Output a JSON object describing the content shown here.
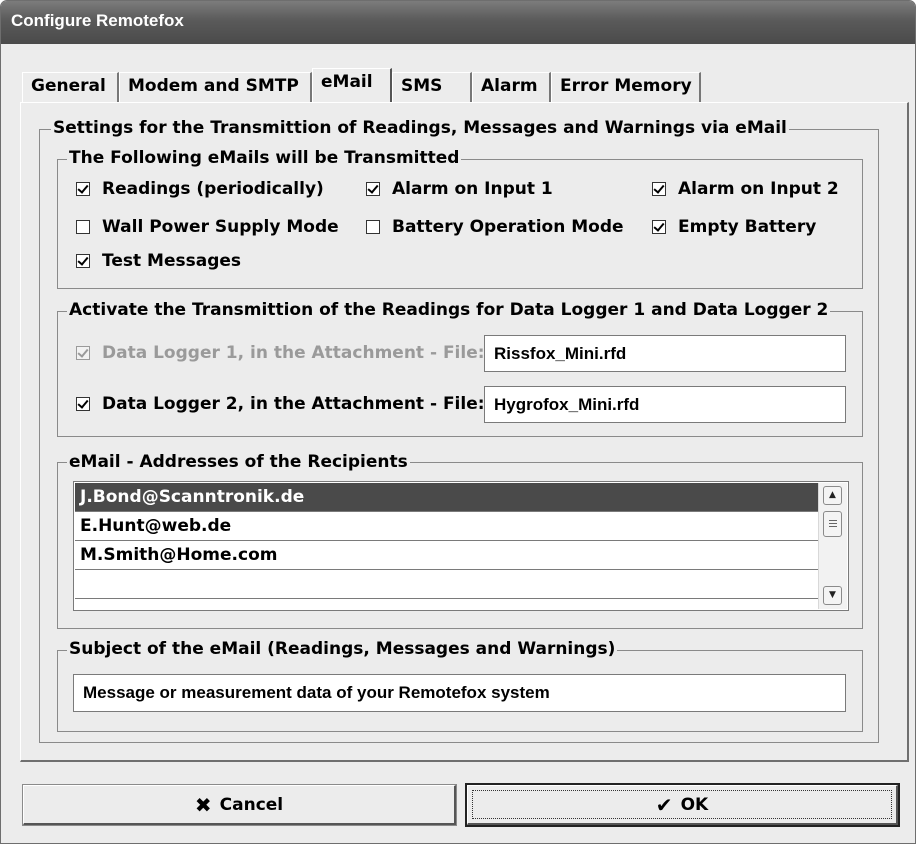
{
  "window": {
    "title": "Configure Remotefox"
  },
  "tabs": [
    {
      "label": "General"
    },
    {
      "label": "Modem and SMTP"
    },
    {
      "label": "eMail",
      "active": true
    },
    {
      "label": "SMS"
    },
    {
      "label": "Alarm"
    },
    {
      "label": "Error Memory"
    }
  ],
  "main": {
    "group_title": "Settings for the Transmittion of Readings, Messages and Warnings via eMail",
    "emails": {
      "title": "The Following eMails will be Transmitted",
      "options": [
        {
          "label": "Readings (periodically)",
          "checked": true
        },
        {
          "label": "Alarm on Input 1",
          "checked": true
        },
        {
          "label": "Alarm on Input 2",
          "checked": true
        },
        {
          "label": "Wall Power Supply Mode",
          "checked": false
        },
        {
          "label": "Battery Operation Mode",
          "checked": false
        },
        {
          "label": "Empty Battery",
          "checked": true
        },
        {
          "label": "Test Messages",
          "checked": true
        }
      ]
    },
    "loggers": {
      "title": "Activate the Transmittion of the Readings for Data Logger 1 and Data Logger 2",
      "items": [
        {
          "label": "Data Logger 1, in the Attachment - File:",
          "checked": true,
          "disabled": true,
          "file": "Rissfox_Mini.rfd"
        },
        {
          "label": "Data Logger 2, in the Attachment - File:",
          "checked": true,
          "disabled": false,
          "file": "Hygrofox_Mini.rfd"
        }
      ]
    },
    "recipients": {
      "title": "eMail - Addresses of the Recipients",
      "items": [
        "J.Bond@Scanntronik.de",
        "E.Hunt@web.de",
        "M.Smith@Home.com",
        ""
      ],
      "selected_index": 0
    },
    "subject": {
      "title": "Subject of the eMail (Readings, Messages and Warnings)",
      "value": "Message or measurement data of your Remotefox system"
    }
  },
  "buttons": {
    "cancel": {
      "label": "Cancel",
      "icon": "x-icon"
    },
    "ok": {
      "label": "OK",
      "icon": "checkmark-icon"
    }
  },
  "colors": {
    "titlebar": "#5a5a5a",
    "selection": "#4a4a4a",
    "face": "#ececec"
  }
}
